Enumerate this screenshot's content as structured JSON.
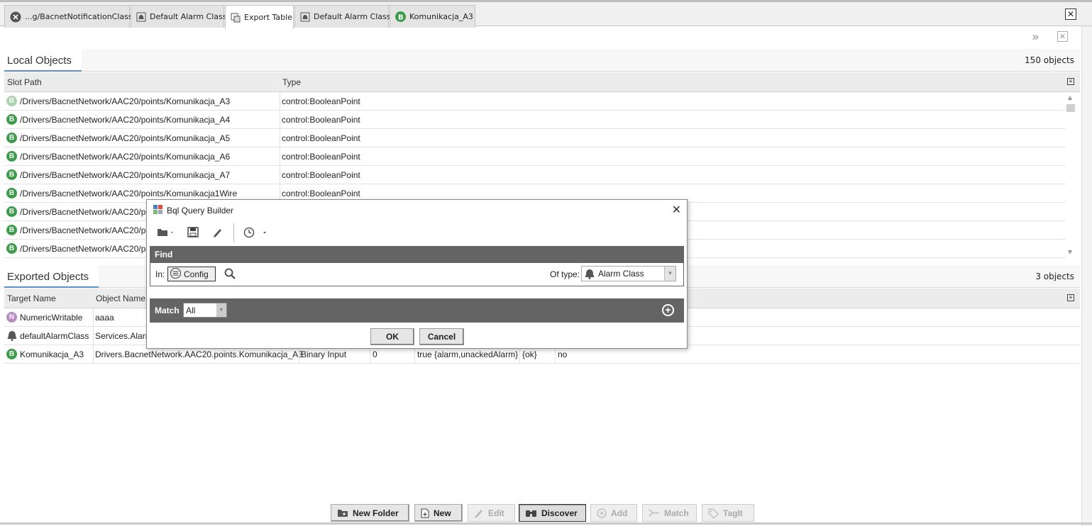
{
  "tabs": [
    {
      "label": "...g/BacnetNotificationClass",
      "icon": "close-circle-icon"
    },
    {
      "label": "Default Alarm Class",
      "icon": "alarm-class-icon"
    },
    {
      "label": "Export Table",
      "icon": "export-table-icon",
      "active": true
    },
    {
      "label": "Default Alarm Class",
      "icon": "alarm-class-icon"
    },
    {
      "label": "Komunikacja_A3",
      "icon": "boolean-point-icon"
    }
  ],
  "local": {
    "title": "Local Objects",
    "count": "150 objects",
    "columns": [
      "Slot Path",
      "Type"
    ],
    "rows": [
      {
        "path": "/Drivers/BacnetNetwork/AAC20/points/Komunikacja_A3",
        "type": "control:BooleanPoint"
      },
      {
        "path": "/Drivers/BacnetNetwork/AAC20/points/Komunikacja_A4",
        "type": "control:BooleanPoint"
      },
      {
        "path": "/Drivers/BacnetNetwork/AAC20/points/Komunikacja_A5",
        "type": "control:BooleanPoint"
      },
      {
        "path": "/Drivers/BacnetNetwork/AAC20/points/Komunikacja_A6",
        "type": "control:BooleanPoint"
      },
      {
        "path": "/Drivers/BacnetNetwork/AAC20/points/Komunikacja_A7",
        "type": "control:BooleanPoint"
      },
      {
        "path": "/Drivers/BacnetNetwork/AAC20/points/Komunikacja1Wire",
        "type": "control:BooleanPoint"
      },
      {
        "path": "/Drivers/BacnetNetwork/AAC20/po",
        "type": ""
      },
      {
        "path": "/Drivers/BacnetNetwork/AAC20/po",
        "type": ""
      },
      {
        "path": "/Drivers/BacnetNetwork/AAC20/po",
        "type": ""
      }
    ]
  },
  "exported": {
    "title": "Exported Objects",
    "count": "3 objects",
    "columns": [
      "Target Name",
      "Object Name"
    ],
    "rows": [
      {
        "target": "NumericWritable",
        "object": "aaaa",
        "objtype": "",
        "instance": "",
        "flags": "",
        "status": "",
        "extra": ""
      },
      {
        "target": "defaultAlarmClass",
        "object": "Services.Alarm",
        "objtype": "",
        "instance": "",
        "flags": "",
        "status": "",
        "extra": ""
      },
      {
        "target": "Komunikacja_A3",
        "object": "Drivers.BacnetNetwork.AAC20.points.Komunikacja_A3",
        "objtype": "Binary Input",
        "instance": "0",
        "flags": "true {alarm,unackedAlarm}",
        "status": "{ok}",
        "extra": "no"
      }
    ]
  },
  "dialog": {
    "title": "Bql Query Builder",
    "find_label": "Find",
    "in_label": "In:",
    "in_value": "Config",
    "of_type_label": "Of type:",
    "of_type_value": "Alarm Class",
    "match_label": "Match",
    "match_value": "All",
    "ok": "OK",
    "cancel": "Cancel"
  },
  "toolbar": {
    "new_folder": "New Folder",
    "new": "New",
    "edit": "Edit",
    "discover": "Discover",
    "add": "Add",
    "match": "Match",
    "tagit": "TagIt"
  }
}
